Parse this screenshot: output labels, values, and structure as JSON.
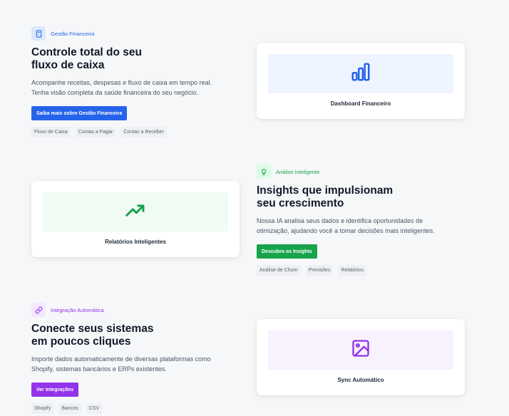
{
  "features": [
    {
      "badge": "Gestão Financeira",
      "title_lines": [
        "Controle total do seu",
        "fluxo de caixa"
      ],
      "description_lines": [
        "Acompanhe receitas, despesas e fluxo de caixa em tempo real.",
        "Tenha visão completa da saúde financeira do seu negócio."
      ],
      "cta": "Saiba mais sobre Gestão Financeira",
      "tags": [
        "Fluxo de Caixa",
        "Contas a Pagar",
        "Contas a Receber"
      ],
      "card_label": "Dashboard Financeiro",
      "card_icon": "bar-chart-icon",
      "accent": "#2563eb",
      "accent_light": "#eef4ff"
    },
    {
      "badge": "Análise Inteligente",
      "title_lines": [
        "Insights que impulsionam",
        "seu crescimento"
      ],
      "description_lines": [
        "Nossa IA analisa seus dados e identifica oportunidades de",
        "otimização, ajudando você a tomar decisões mais inteligentes."
      ],
      "cta": "Descubra os Insights",
      "tags": [
        "Análise de Churn",
        "Previsões",
        "Relatórios"
      ],
      "card_label": "Relatórios Inteligentes",
      "card_icon": "trending-up-icon",
      "accent": "#16a34a",
      "accent_light": "#effbf3"
    },
    {
      "badge": "Integração Automática",
      "title_lines": [
        "Conecte seus sistemas",
        "em poucos cliques"
      ],
      "description_lines": [
        "Importe dados automaticamente de diversas plataformas como",
        "Shopify, sistemas bancários e ERPs existentes."
      ],
      "cta": "Ver Integrações",
      "tags": [
        "Shopify",
        "Bancos",
        "CSV"
      ],
      "card_label": "Sync Automático",
      "card_icon": "image-icon",
      "accent": "#9333ea",
      "accent_light": "#f8f1fe"
    }
  ]
}
